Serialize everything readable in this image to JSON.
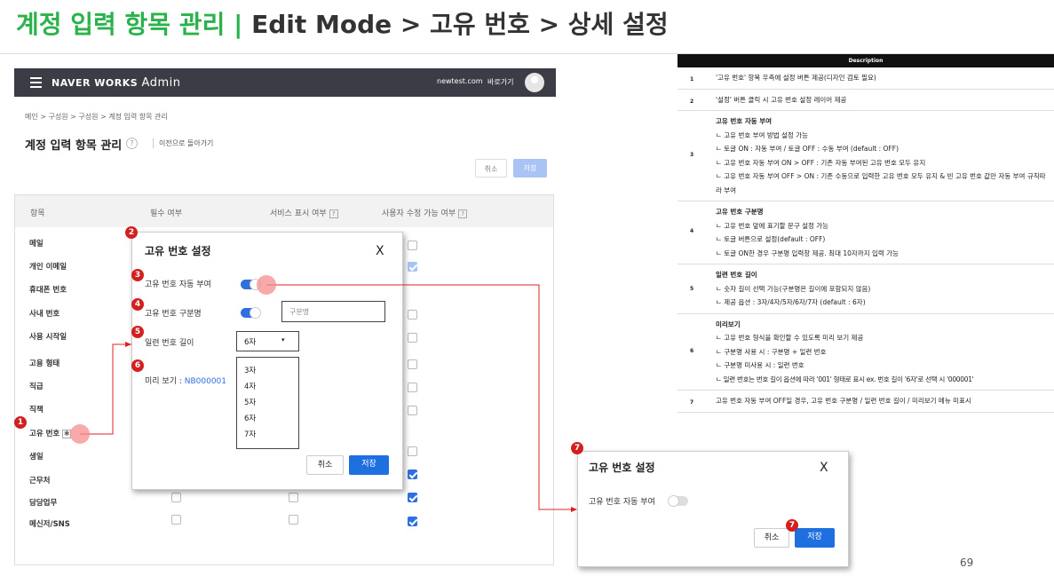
{
  "slide_title": {
    "part1": "계정 입력 항목 관리 |",
    "part2": "Edit Mode > 고유 번호 > 상세 설정"
  },
  "admin": {
    "brand": "NAVER WORKS",
    "brand_suffix": "Admin",
    "domain": "newtest.com",
    "shortcut": "바로가기",
    "breadcrumb": "메인 > 구성원 > 구성원 > 계정 입력 항목 관리",
    "page_title": "계정 입력 항목 관리",
    "help": "?",
    "back_link": "이전으로 돌아가기",
    "cancel": "취소",
    "save": "저장",
    "columns": {
      "item": "항목",
      "required": "필수 여부",
      "service": "서비스 표시 여부",
      "editable": "사용자 수정 가능 여부"
    },
    "rows": [
      "메일",
      "개인 이메일",
      "휴대폰 번호",
      "사내 번호",
      "사용 시작일",
      "고용 형태",
      "직급",
      "직책",
      "고유 번호",
      "생일",
      "근무처",
      "담당업무",
      "메신저/SNS"
    ]
  },
  "modal1": {
    "title": "고유 번호 설정",
    "close": "X",
    "auto_label": "고유 번호 자동 부여",
    "prefix_label": "고유 번호 구분명",
    "prefix_placeholder": "구분명",
    "length_label": "일련 번호 길이",
    "length_value": "6자",
    "length_caret": "▾",
    "length_options": [
      "3자",
      "4자",
      "5자",
      "6자",
      "7자"
    ],
    "preview_label": "미리 보기 :",
    "preview_value": "NB000001",
    "cancel": "취소",
    "save": "저장"
  },
  "modal2": {
    "title": "고유 번호 설정",
    "close": "X",
    "auto_label": "고유 번호 자동 부여",
    "cancel": "취소",
    "save": "저장"
  },
  "badges": [
    "1",
    "2",
    "3",
    "4",
    "5",
    "6",
    "7"
  ],
  "description": {
    "header": "Description",
    "rows": [
      {
        "num": "1",
        "lines": [
          "'고유 번호' 항목 우측에 설정 버튼 제공(디자인 검토 필요)"
        ]
      },
      {
        "num": "2",
        "lines": [
          "'설정' 버튼 클릭 시 고유 번호 설정 레이어 제공"
        ]
      },
      {
        "num": "3",
        "heading": "고유 번호 자동 부여",
        "lines": [
          "ㄴ 고유 번호 부여 방법 설정 가능",
          "ㄴ 토글 ON : 자동 부여 / 토글 OFF : 수동 부여 (default : OFF)",
          "ㄴ 고유 번호 자동 부여 ON > OFF : 기존 자동 부여된 고유 번호 모두 유지",
          "ㄴ 고유 번호 자동 부여 OFF > ON : 기존 수동으로 입력한 고유 번호 모두 유지 & 빈 고유 번호 값만 자동 부여 규칙따라 부여"
        ]
      },
      {
        "num": "4",
        "heading": "고유 번호 구분명",
        "lines": [
          "ㄴ 고유 번호 앞에 표기할 문구 설정 가능",
          "ㄴ 토글 버튼으로 설정(default : OFF)",
          "ㄴ 토글 ON한 경우 구분명 입력창 제공. 최대 10자까지 입력 가능"
        ]
      },
      {
        "num": "5",
        "heading": "일련 번호 길이",
        "lines": [
          "ㄴ 숫자 길이 선택 가능(구분명은 길이에 포함되지 않음)",
          "ㄴ 제공 옵션 : 3자/4자/5자/6자/7자 (default : 6자)"
        ]
      },
      {
        "num": "6",
        "heading": "미리보기",
        "lines": [
          "ㄴ 고유 번호 형식을 확인할 수 있도록 미리 보기 제공",
          "ㄴ 구분명 사용 시 : 구분명 + 일련 번호",
          "ㄴ 구분명 미사용 시 : 일련 번호",
          "ㄴ 일련 번호는 번호 길이 옵션에 따라 '001' 형태로 표시 ex. 번호 길이 '6자'로 선택 시 '000001'"
        ]
      },
      {
        "num": "7",
        "lines": [
          "고유 번호 자동 부여 OFF일 경우, 고유 번호 구분명 / 일련 번호 길이 / 미리보기 메뉴 미표시"
        ]
      }
    ]
  },
  "page_number": "69",
  "colors": {
    "title_green": "#2bb24c",
    "accent_blue": "#2f6fe0",
    "badge_red": "#d21f1f",
    "topbar": "#3c3c46"
  }
}
